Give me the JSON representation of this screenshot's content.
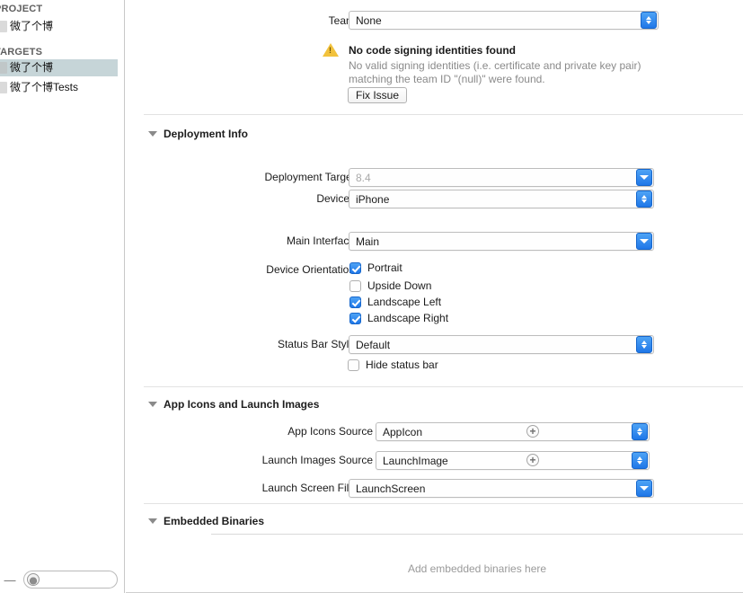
{
  "sidebar": {
    "project_group_label": "PROJECT",
    "targets_group_label": "TARGETS",
    "project_items": [
      {
        "label": "微了个博"
      }
    ],
    "target_items": [
      {
        "label": "微了个博",
        "selected": true
      },
      {
        "label": "微了个博Tests",
        "selected": false
      }
    ],
    "footer": {
      "remove_label": "—",
      "filter_placeholder": "",
      "filter_value": ""
    }
  },
  "signing": {
    "team_label": "Team",
    "team_value": "None",
    "warning_title": "No code signing identities found",
    "warning_body": "No valid signing identities (i.e. certificate and private key pair) matching the team ID \"(null)\" were found.",
    "fix_issue_label": "Fix Issue"
  },
  "deployment_info": {
    "section_title": "Deployment Info",
    "deployment_target_label": "Deployment Target",
    "deployment_target_value": "8.4",
    "devices_label": "Devices",
    "devices_value": "iPhone",
    "main_interface_label": "Main Interface",
    "main_interface_value": "Main",
    "device_orientation_label": "Device Orientation",
    "orientations": [
      {
        "label": "Portrait",
        "checked": true
      },
      {
        "label": "Upside Down",
        "checked": false
      },
      {
        "label": "Landscape Left",
        "checked": true
      },
      {
        "label": "Landscape Right",
        "checked": true
      }
    ],
    "status_bar_style_label": "Status Bar Style",
    "status_bar_style_value": "Default",
    "hide_status_bar_label": "Hide status bar",
    "hide_status_bar_checked": false
  },
  "app_icons": {
    "section_title": "App Icons and Launch Images",
    "app_icons_source_label": "App Icons Source",
    "app_icons_source_value": "AppIcon",
    "launch_images_source_label": "Launch Images Source",
    "launch_images_source_value": "LaunchImage",
    "launch_screen_file_label": "Launch Screen File",
    "launch_screen_file_value": "LaunchScreen",
    "add_glyph": "+"
  },
  "embedded_binaries": {
    "section_title": "Embedded Binaries",
    "placeholder": "Add embedded binaries here"
  },
  "colors": {
    "accent_blue": "#1f77e8",
    "warning_yellow": "#f2c23c",
    "selection": "#c6d5d8"
  }
}
